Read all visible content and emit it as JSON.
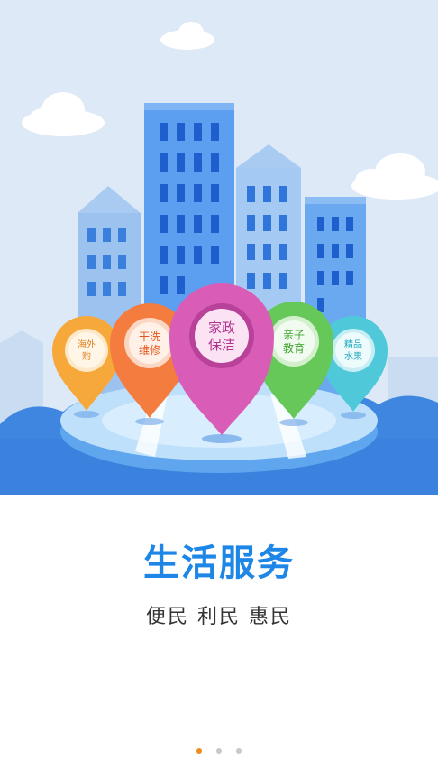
{
  "hero": {
    "pins": [
      {
        "id": "overseas",
        "line1": "海外",
        "line2": "购",
        "color": "#f6a83a"
      },
      {
        "id": "laundry",
        "line1": "干洗",
        "line2": "维修",
        "color": "#f47c3f"
      },
      {
        "id": "housekeeping",
        "line1": "家政",
        "line2": "保洁",
        "color": "#d95db6"
      },
      {
        "id": "education",
        "line1": "亲子",
        "line2": "教育",
        "color": "#67c85a"
      },
      {
        "id": "fruit",
        "line1": "精品",
        "line2": "水果",
        "color": "#4fc9d9"
      }
    ]
  },
  "main": {
    "title": "生活服务",
    "subtitle": "便民  利民  惠民"
  },
  "pager": {
    "count": 3,
    "active_index": 0,
    "active_color": "#f08c1e",
    "inactive_color": "#c9c9c9"
  }
}
